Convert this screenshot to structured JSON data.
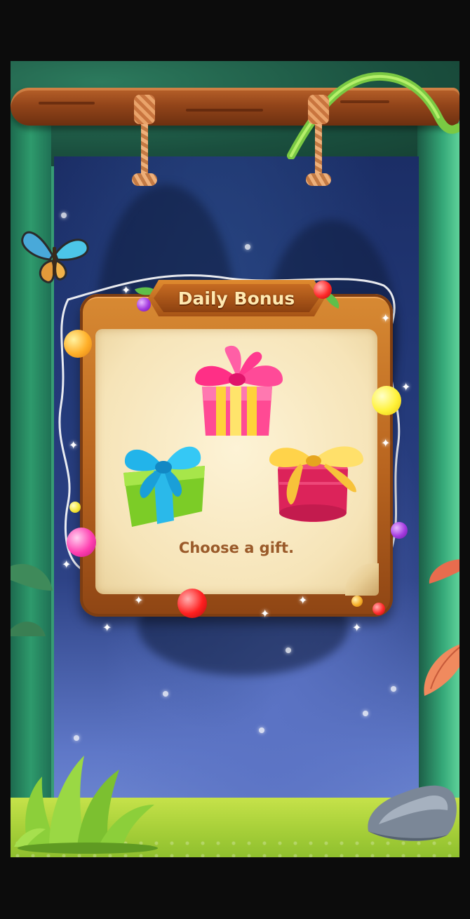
{
  "game": {
    "title": "Daily Bonus",
    "prompt": "Choose a gift."
  },
  "gifts": [
    {
      "name": "pink-gift-box",
      "color": "#ff3f8e",
      "ribbon": "#ffd23a"
    },
    {
      "name": "green-gift-box",
      "color": "#86d12c",
      "ribbon": "#29c8f0"
    },
    {
      "name": "round-pink-gift-box",
      "color": "#e0285d",
      "ribbon": "#ffd34a"
    }
  ],
  "decor": {
    "icons": [
      "butterfly-icon",
      "rope-knot-icon",
      "vine-icon",
      "sparkle-icon",
      "light-bulb-icon",
      "rock-icon",
      "grass-icon"
    ],
    "colors": {
      "wood": "#b8641f",
      "paper": "#f6e4b8",
      "title_text": "#ffe9b0",
      "prompt_text": "#9a5a2a"
    }
  }
}
